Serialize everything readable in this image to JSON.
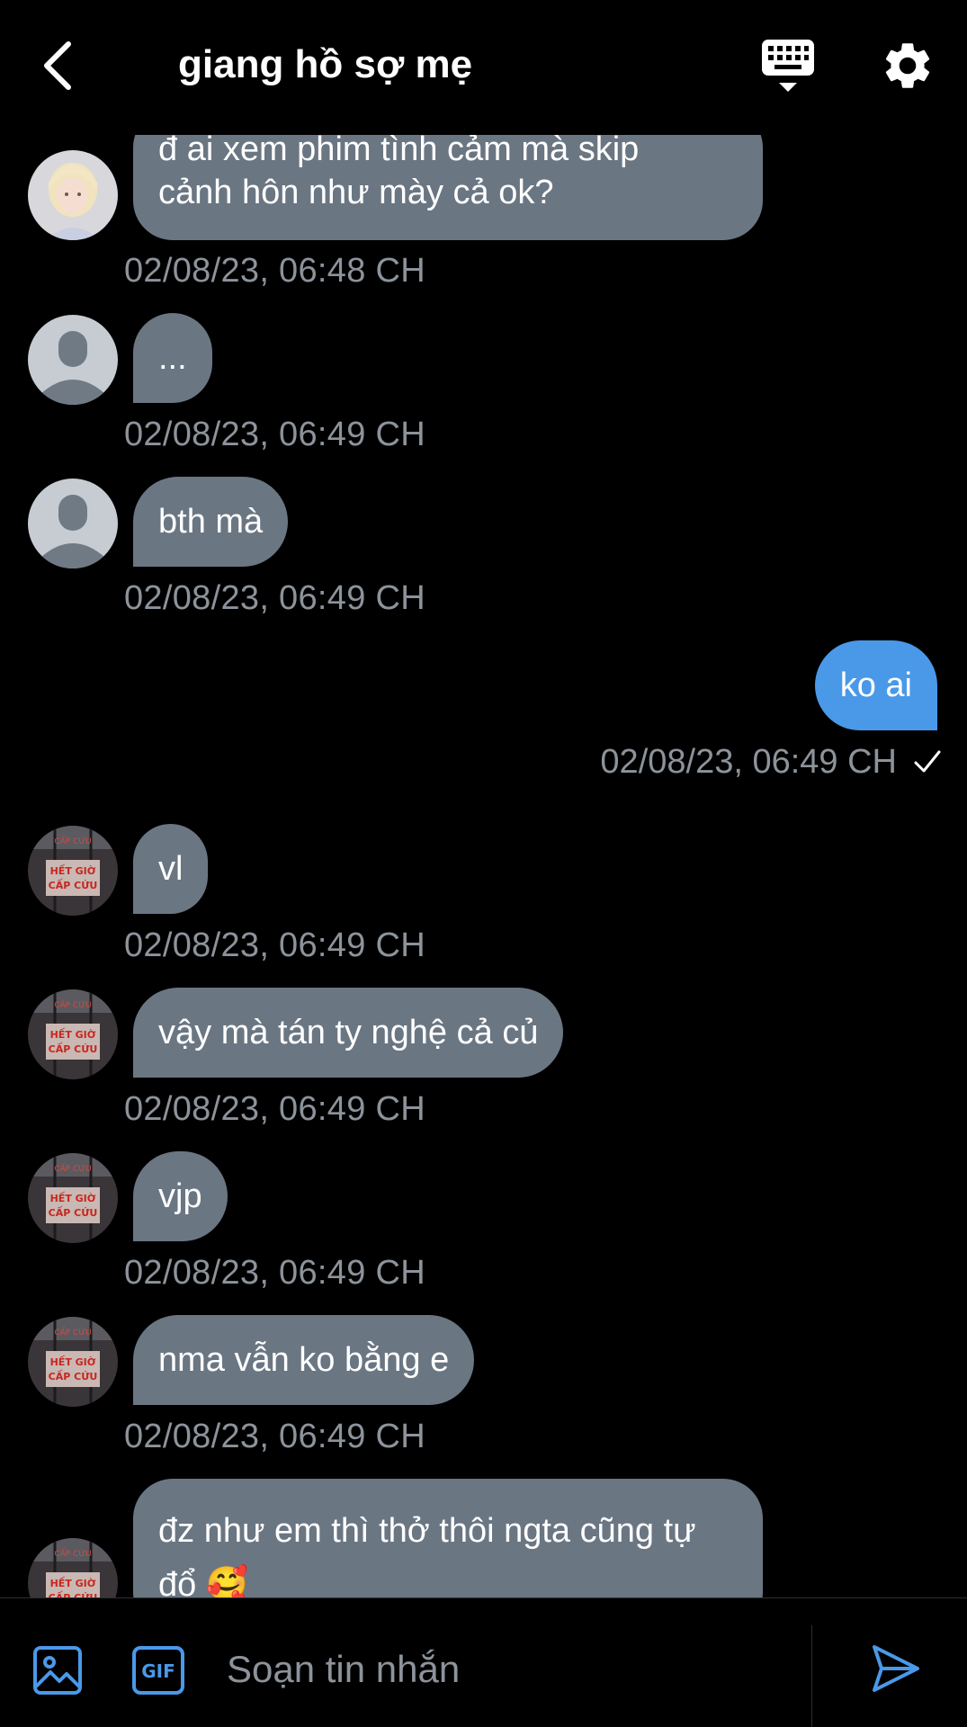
{
  "header": {
    "title": "giang hồ sợ mẹ",
    "back_icon": "chevron-left-icon",
    "keyboard_icon": "keyboard-icon",
    "settings_icon": "gear-icon"
  },
  "messages": [
    {
      "sender": "other",
      "avatar": "photo-girl",
      "text_lines": [
        "đ ai xem phim tình cảm mà skip",
        "cảnh hôn như mày cả ok?"
      ],
      "time": "02/08/23, 06:48 CH"
    },
    {
      "sender": "other",
      "avatar": "default-person",
      "text": "...",
      "time": "02/08/23, 06:49 CH"
    },
    {
      "sender": "other",
      "avatar": "default-person",
      "text": "bth mà",
      "time": "02/08/23, 06:49 CH"
    },
    {
      "sender": "me",
      "text": "ko ai",
      "time": "02/08/23, 06:49 CH",
      "status_icon": "checkmark-icon"
    },
    {
      "sender": "other",
      "avatar": "sign-photo",
      "text": "vl",
      "time": "02/08/23, 06:49 CH"
    },
    {
      "sender": "other",
      "avatar": "sign-photo",
      "text": "vậy mà tán ty nghệ cả củ",
      "time": "02/08/23, 06:49 CH"
    },
    {
      "sender": "other",
      "avatar": "sign-photo",
      "text": "vjp",
      "time": "02/08/23, 06:49 CH"
    },
    {
      "sender": "other",
      "avatar": "sign-photo",
      "text": "nma vẫn ko bằng e",
      "time": "02/08/23, 06:49 CH"
    },
    {
      "sender": "other",
      "avatar": "sign-photo",
      "text_lines": [
        "đz như em thì thở thôi ngta cũng tự",
        "đổ 🥰"
      ]
    }
  ],
  "avatar_sign": {
    "top_text": "CẤP CỨU",
    "line1": "HẾT GIỜ",
    "line2": "CẤP CỨU"
  },
  "composer": {
    "placeholder": "Soạn tin nhắn",
    "image_icon": "image-icon",
    "gif_label": "GIF",
    "send_icon": "send-icon"
  },
  "colors": {
    "background": "#000000",
    "incoming_bubble": "#6b7683",
    "outgoing_bubble": "#4a99e9",
    "timestamp": "#8d939b",
    "accent": "#4a99e9"
  }
}
